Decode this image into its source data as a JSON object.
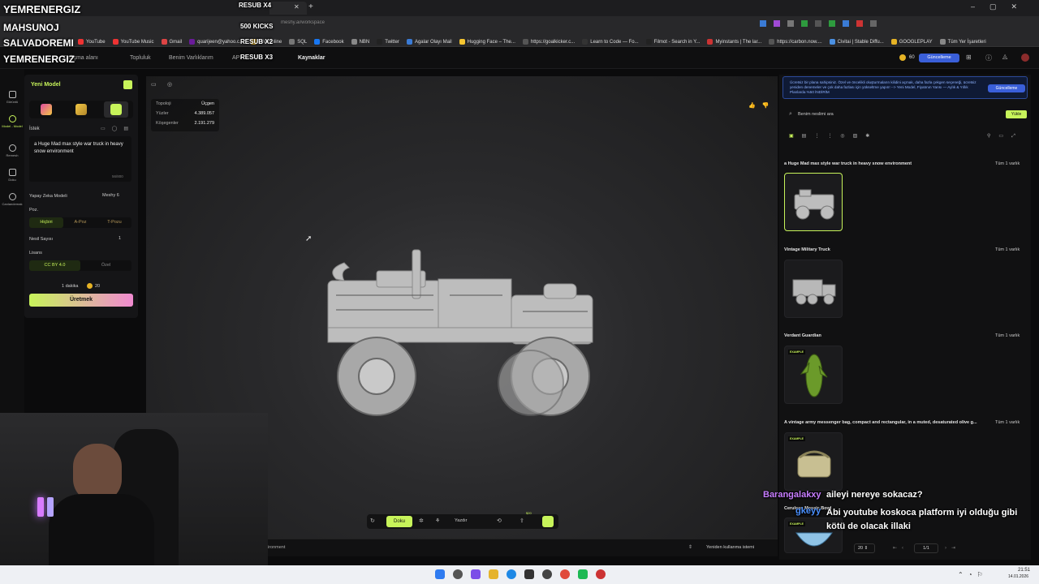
{
  "browser": {
    "tab_title": "meshy.ai",
    "url": "meshy.ai/workspace",
    "bookmarks": [
      "YouTube",
      "YouTube Music",
      "Gmail",
      "quarijeen@yahoo.c...",
      "Webonline",
      "SQL",
      "Facebook",
      "NBN",
      "Twitter",
      "Agalar Olayı Mail",
      "Hugging Face – The...",
      "https://goalkicker.c...",
      "Learn to Code — Fo...",
      "Filmot - Search in Y...",
      "Myinstants | The lar...",
      "https://carbon.now....",
      "Civitai | Stable Diffu...",
      "GOOGLEPLAY",
      "Tüm Yer İşaretleri"
    ],
    "colors": {
      "accent": "#c7f35a",
      "bg": "#0b0b0c"
    }
  },
  "overlay": {
    "names": [
      "YEMRENERGIZ",
      "MAHSUNOJ",
      "SALVADOREMI",
      "YEMRENERGIZ"
    ],
    "resub": [
      "RESUB X4",
      "500 KICKS",
      "RESUB X2",
      "RESUB X3"
    ]
  },
  "nav": {
    "links": [
      "Çalışma alanı",
      "Topluluk",
      "Benim Varlıklarım",
      "API",
      "Kaynaklar"
    ],
    "credits": "60",
    "upgrade": "Güncelleme"
  },
  "rail": [
    "Görüntü",
    "Model - Model",
    "Remesh",
    "Doku",
    "Canlandırmak"
  ],
  "left": {
    "title": "Yeni Model",
    "prompt_label": "İstek",
    "prompt_text": "a Huge Mad max style war truck in heavy snow environment",
    "char_count": "56/800",
    "ai_model_label": "Yapay Zeka Modeli",
    "ai_model_value": "Meshy 6",
    "pose_label": "Poz.",
    "pose_options": [
      "Hiçbiri",
      "A-Poz",
      "T-Pozu"
    ],
    "gen_count_label": "Nesil Sayısı",
    "gen_count_value": "1",
    "license_label": "Lisans",
    "license_options": [
      "CC BY 4.0",
      "Özel"
    ],
    "eta": "1 dakika",
    "cost": "20",
    "generate": "Üretmek"
  },
  "viewport": {
    "stats": [
      {
        "k": "Topoloji",
        "v": "Üçgen"
      },
      {
        "k": "Yüzler",
        "v": "4.389.057"
      },
      {
        "k": "Köşegenler",
        "v": "2.191.279"
      }
    ],
    "toolbar": {
      "texture": "Doku",
      "print": "Yazdır",
      "badge": "$20"
    },
    "footer_left": "ironment",
    "footer_right": "Yeniden kullanma istemi"
  },
  "right": {
    "promo": "Ücretsiz bir plana sahipsiniz. Özel ve öncelikli oluşturmaların kilidini açmak, daha fazla çekgen seçeneği, ücretsiz yeniden denemeler ve çok daha fazlası için yükseltme yapın! --> Yeni Model, Fiyatının Yarısı — Aylık & Yıllık Planlarda %50 İNDİRİM",
    "promo_button": "Güncelleme",
    "search_placeholder": "Benim neslimi ara",
    "upload": "Yükle",
    "assets": [
      {
        "title": "a Huge Mad max style war truck in heavy snow environment",
        "count": "Tüm 1 varlık"
      },
      {
        "title": "Vintage Military Truck",
        "count": "Tüm 1 varlık"
      },
      {
        "title": "Verdant Guardian",
        "count": "Tüm 1 varlık",
        "badge": "EXAMPLE"
      },
      {
        "title": "A vintage army messenger bag, compact and rectangular, in a muted, desaturated olive g...",
        "count": "Tüm 1 varlık",
        "badge": "EXAMPLE"
      },
      {
        "title": "Cerulean Mosaic Bowl",
        "count": "",
        "badge": "EXAMPLE"
      }
    ],
    "page_size": "20",
    "page": "1/1"
  },
  "chat": [
    {
      "user": "Barangalakxy",
      "msg": "aileyi nereye sokacaz?",
      "color": "#c77dff"
    },
    {
      "user": "gkeyy",
      "msg": "Abi youtube koskoca platform iyi olduğu gibi kötü de olacak illaki",
      "color": "#4a90ff"
    }
  ],
  "taskbar": {
    "time": "21:51",
    "date": "14.01.2026"
  }
}
